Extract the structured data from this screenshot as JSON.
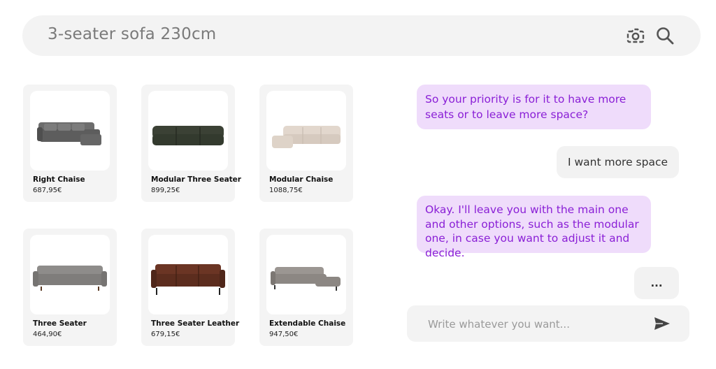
{
  "search": {
    "query": "3-seater sofa 230cm"
  },
  "icons": {
    "camera": "camera-search-icon",
    "search": "search-icon",
    "send": "send-icon"
  },
  "products": [
    {
      "name": "Right Chaise",
      "price": "687,95€"
    },
    {
      "name": "Modular Three Seater",
      "price": "899,25€"
    },
    {
      "name": "Modular Chaise",
      "price": "1088,75€"
    },
    {
      "name": "Three Seater",
      "price": "464,90€"
    },
    {
      "name": "Three Seater Leather",
      "price": "679,15€"
    },
    {
      "name": "Extendable Chaise",
      "price": "947,50€"
    }
  ],
  "chat": {
    "messages": [
      {
        "from": "bot",
        "text": "So your priority is for it to have more seats or to leave more space?"
      },
      {
        "from": "user",
        "text": "I want more space"
      },
      {
        "from": "bot",
        "text": "Okay. I'll leave you with the main one and other options, such as the modular one, in case you want to adjust it and decide."
      },
      {
        "from": "user",
        "text": "..."
      }
    ],
    "input_placeholder": "Write whatever you want..."
  },
  "colors": {
    "accent": "#8a1fd6",
    "bot_bubble": "#efdcfb",
    "surface": "#f3f3f3"
  }
}
